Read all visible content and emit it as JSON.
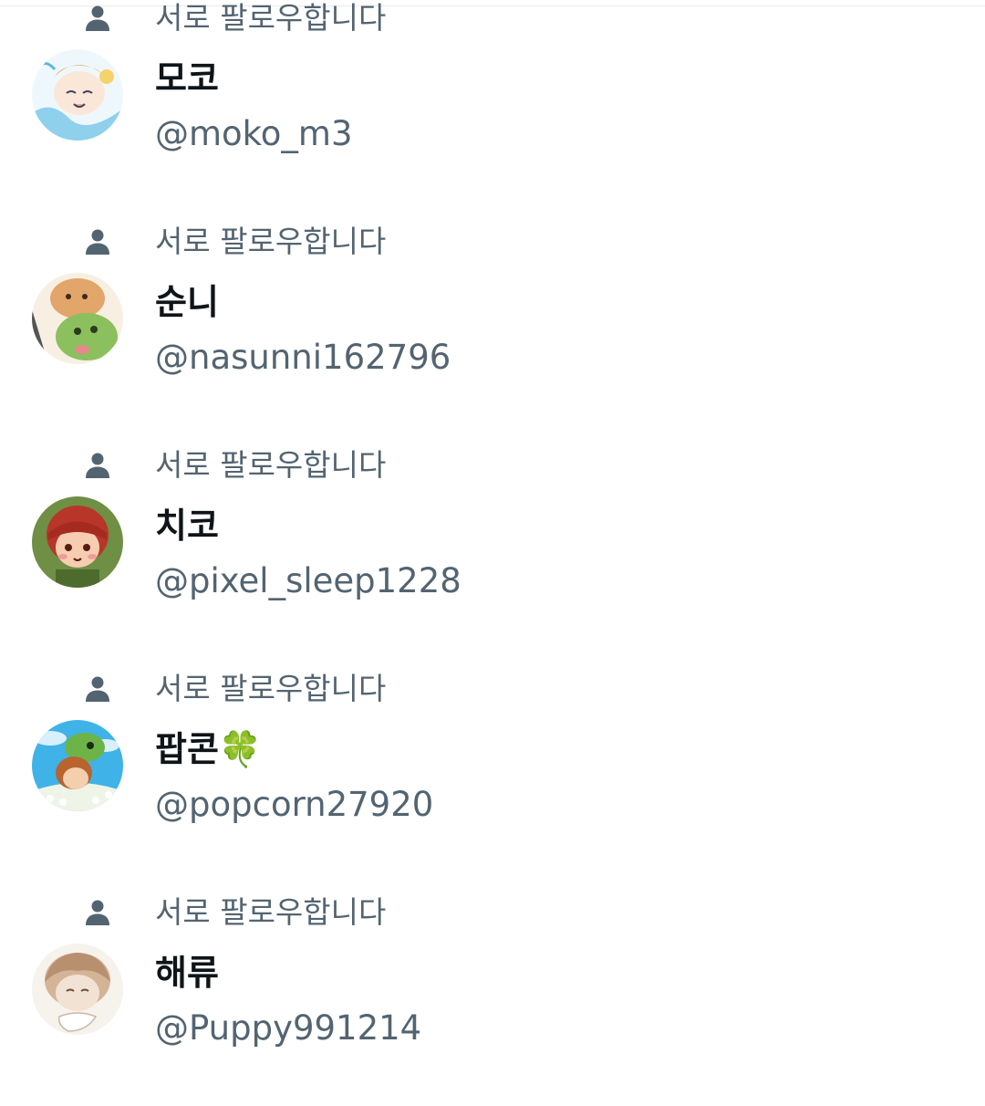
{
  "follow_context_label": "서로 팔로우합니다",
  "users": [
    {
      "display_name": "모코",
      "handle": "@moko_m3",
      "avatar_colors": [
        "#e8f4fa",
        "#7fc6e4",
        "#f2c6a8"
      ]
    },
    {
      "display_name": "순니",
      "handle": "@nasunni162796",
      "avatar_colors": [
        "#f5ead5",
        "#d99a5c",
        "#7fb05a"
      ]
    },
    {
      "display_name": "치코",
      "handle": "@pixel_sleep1228",
      "avatar_colors": [
        "#6b8a3e",
        "#c0392b",
        "#f5c8a8"
      ]
    },
    {
      "display_name": "팝콘🍀",
      "handle": "@popcorn27920",
      "avatar_colors": [
        "#3fb3e8",
        "#7fc04a",
        "#f2f2e8"
      ]
    },
    {
      "display_name": "해류",
      "handle": "@Puppy991214",
      "avatar_colors": [
        "#f3eee8",
        "#c9a78a",
        "#e8d6c4"
      ]
    }
  ],
  "colors": {
    "secondary_text": "#536471",
    "primary_text": "#0f1419",
    "divider": "#e6e9ec"
  }
}
